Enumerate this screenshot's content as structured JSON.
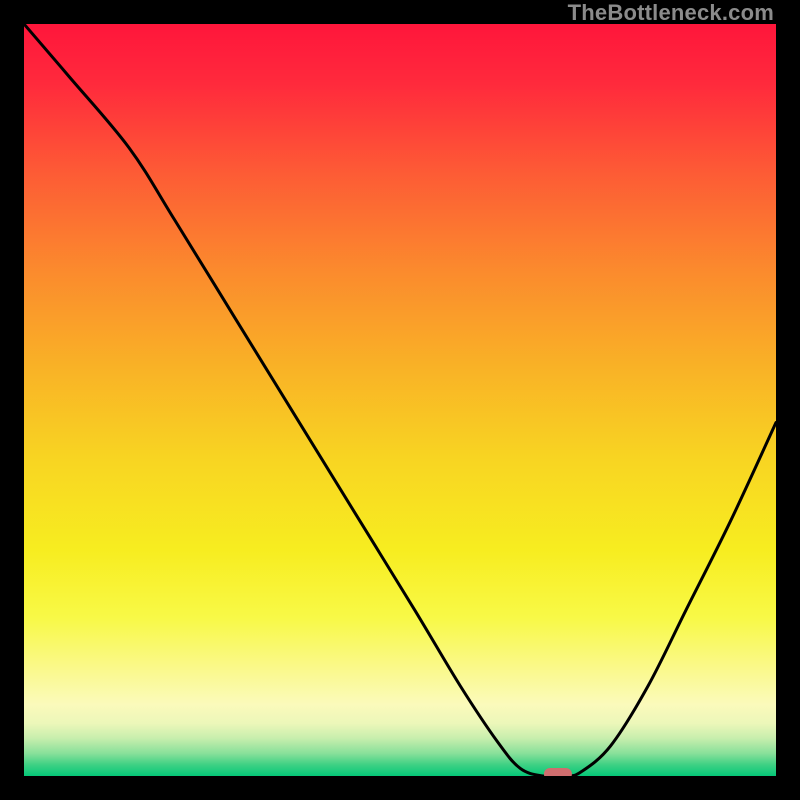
{
  "watermark": "TheBottleneck.com",
  "chart_data": {
    "type": "line",
    "title": "",
    "xlabel": "",
    "ylabel": "",
    "xlim": [
      0,
      100
    ],
    "ylim": [
      0,
      100
    ],
    "grid": false,
    "legend": false,
    "series": [
      {
        "name": "curve",
        "x": [
          0,
          6,
          14,
          20,
          28,
          36,
          44,
          52,
          58,
          63,
          66,
          69,
          72,
          74,
          78,
          83,
          88,
          94,
          100
        ],
        "y": [
          100,
          93,
          83.5,
          74,
          61,
          48,
          35,
          22,
          12,
          4.5,
          1,
          0,
          0,
          0.5,
          4,
          12,
          22,
          34,
          47
        ]
      }
    ],
    "marker": {
      "name": "highlight-pill",
      "x": 71,
      "y": 0,
      "color": "#cf6d6e"
    },
    "gradient": {
      "stops": [
        {
          "offset": 0.0,
          "color": "#ff163b"
        },
        {
          "offset": 0.08,
          "color": "#ff2a3c"
        },
        {
          "offset": 0.2,
          "color": "#fd5c35"
        },
        {
          "offset": 0.33,
          "color": "#fb8b2d"
        },
        {
          "offset": 0.46,
          "color": "#f9b326"
        },
        {
          "offset": 0.58,
          "color": "#f8d522"
        },
        {
          "offset": 0.7,
          "color": "#f7ed20"
        },
        {
          "offset": 0.79,
          "color": "#f8f947"
        },
        {
          "offset": 0.86,
          "color": "#faf98e"
        },
        {
          "offset": 0.905,
          "color": "#fbfabb"
        },
        {
          "offset": 0.93,
          "color": "#ecf7b9"
        },
        {
          "offset": 0.95,
          "color": "#c7eead"
        },
        {
          "offset": 0.97,
          "color": "#88e09a"
        },
        {
          "offset": 0.985,
          "color": "#3ed184"
        },
        {
          "offset": 1.0,
          "color": "#05c778"
        }
      ]
    }
  }
}
